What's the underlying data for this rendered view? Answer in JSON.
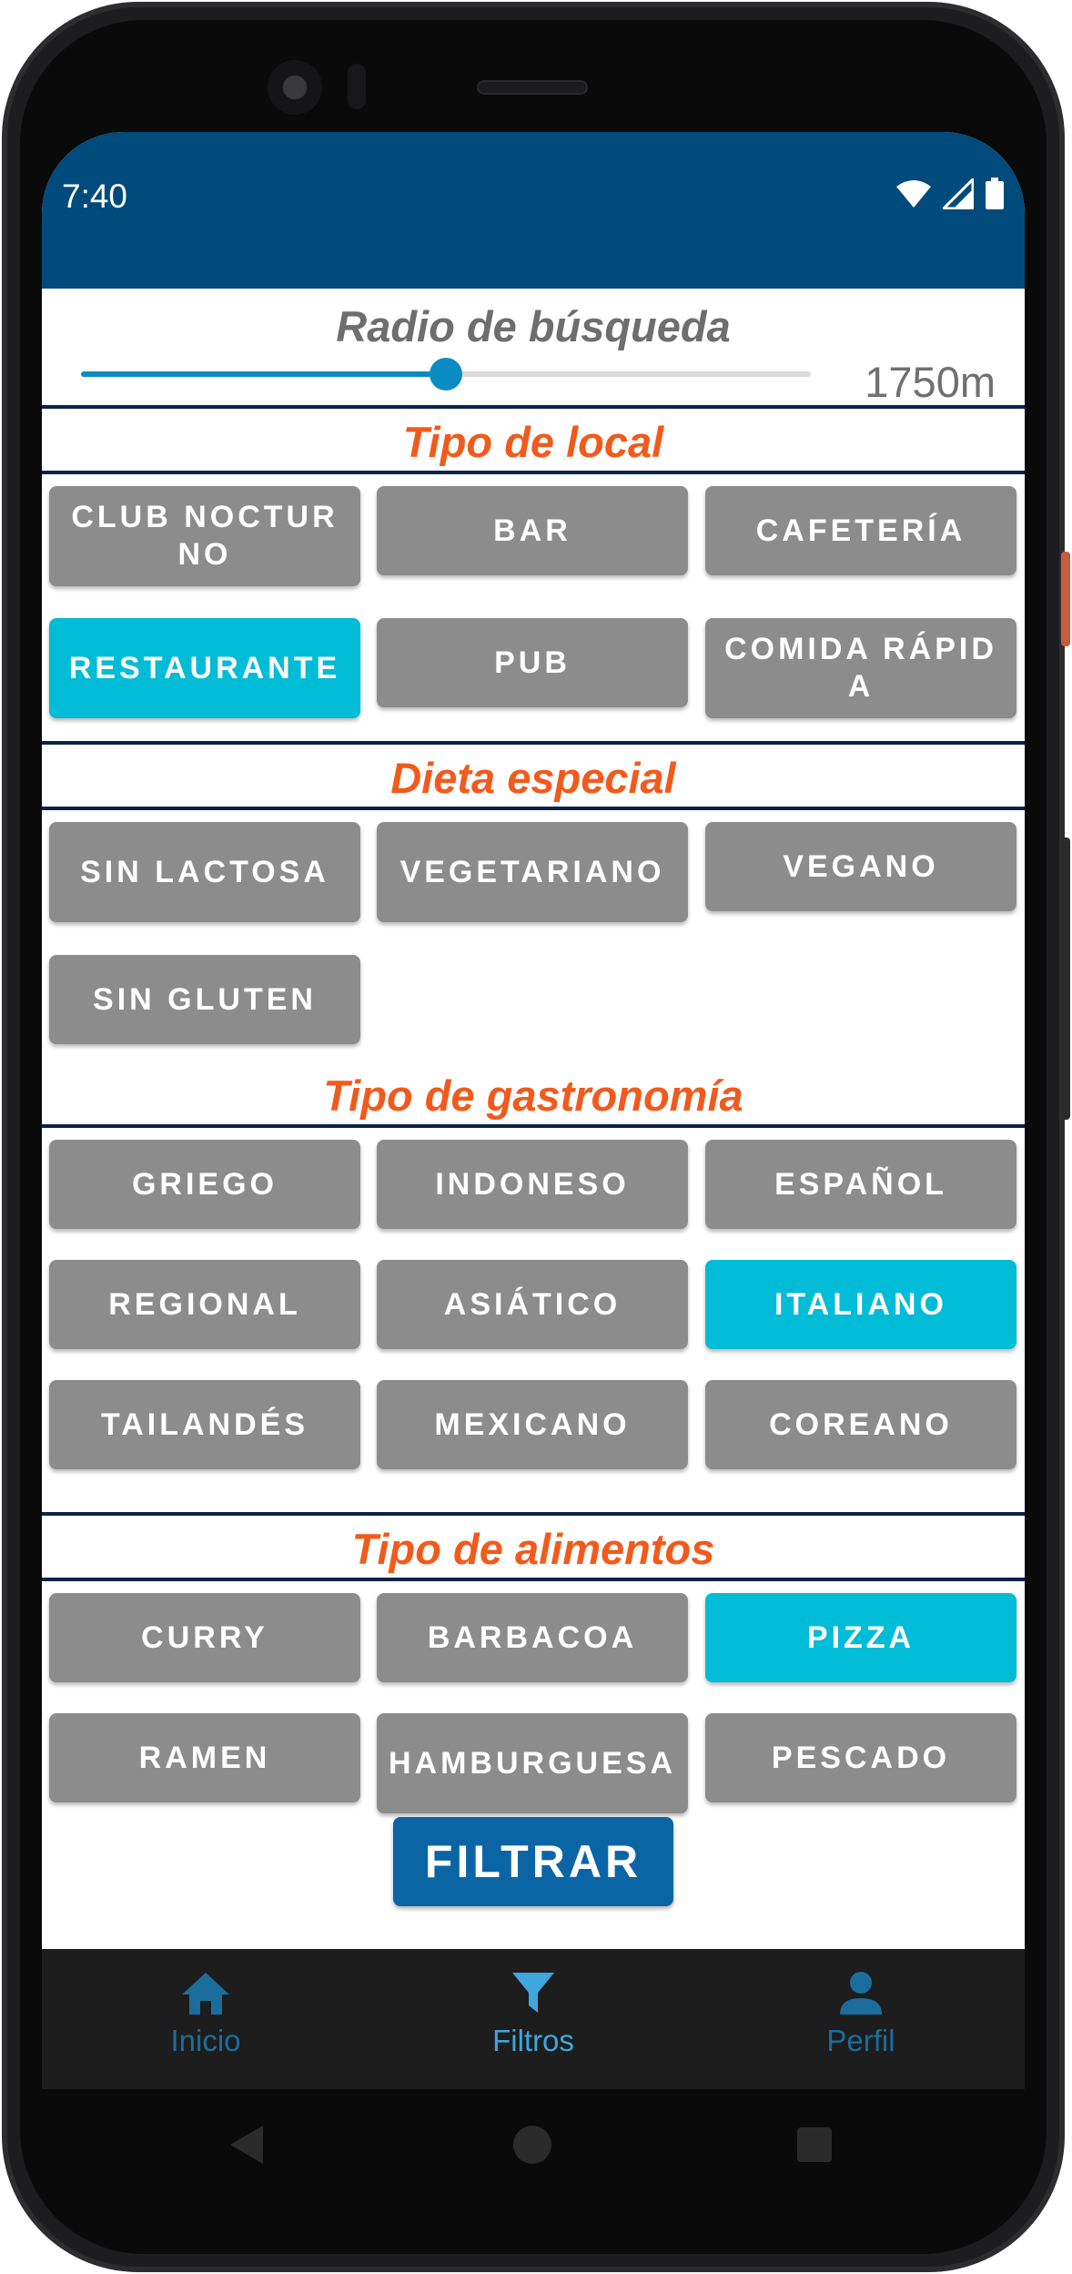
{
  "status_bar": {
    "time": "7:40"
  },
  "search_radius": {
    "title": "Radio de búsqueda",
    "value_label": "1750m",
    "slider_fraction": 0.5
  },
  "sections": {
    "local": {
      "title": "Tipo de local",
      "options": [
        {
          "label": "CLUB NOCTURNO",
          "selected": false
        },
        {
          "label": "BAR",
          "selected": false
        },
        {
          "label": "CAFETERÍA",
          "selected": false
        },
        {
          "label": "RESTAURANTE",
          "selected": true
        },
        {
          "label": "PUB",
          "selected": false
        },
        {
          "label": "COMIDA RÁPIDA",
          "selected": false
        }
      ]
    },
    "dieta": {
      "title": "Dieta especial",
      "options": [
        {
          "label": "SIN LACTOSA",
          "selected": false
        },
        {
          "label": "VEGETARIANO",
          "selected": false
        },
        {
          "label": "VEGANO",
          "selected": false
        },
        {
          "label": "SIN GLUTEN",
          "selected": false
        }
      ]
    },
    "gastronomia": {
      "title": "Tipo de gastronomía",
      "options": [
        {
          "label": "GRIEGO",
          "selected": false
        },
        {
          "label": "INDONESO",
          "selected": false
        },
        {
          "label": "ESPAÑOL",
          "selected": false
        },
        {
          "label": "REGIONAL",
          "selected": false
        },
        {
          "label": "ASIÁTICO",
          "selected": false
        },
        {
          "label": "ITALIANO",
          "selected": true
        },
        {
          "label": "TAILANDÉS",
          "selected": false
        },
        {
          "label": "MEXICANO",
          "selected": false
        },
        {
          "label": "COREANO",
          "selected": false
        }
      ]
    },
    "alimentos": {
      "title": "Tipo de alimentos",
      "options": [
        {
          "label": "CURRY",
          "selected": false
        },
        {
          "label": "BARBACOA",
          "selected": false
        },
        {
          "label": "PIZZA",
          "selected": true
        },
        {
          "label": "RAMEN",
          "selected": false
        },
        {
          "label": "HAMBURGUESA",
          "selected": false
        },
        {
          "label": "PESCADO",
          "selected": false
        }
      ]
    }
  },
  "filter_button": {
    "label": "FILTRAR"
  },
  "bottom_nav": {
    "items": [
      {
        "label": "Inicio",
        "icon": "home-icon",
        "active": false
      },
      {
        "label": "Filtros",
        "icon": "filter-icon",
        "active": true
      },
      {
        "label": "Perfil",
        "icon": "person-icon",
        "active": false
      }
    ]
  },
  "colors": {
    "app_bar": "#004b7b",
    "section_title": "#f25a1c",
    "chip_default": "#8c8c8c",
    "chip_selected": "#00bcd6",
    "primary_button": "#0b65a5",
    "nav_active": "#3ea7de",
    "nav_inactive": "#1b6e9c"
  }
}
